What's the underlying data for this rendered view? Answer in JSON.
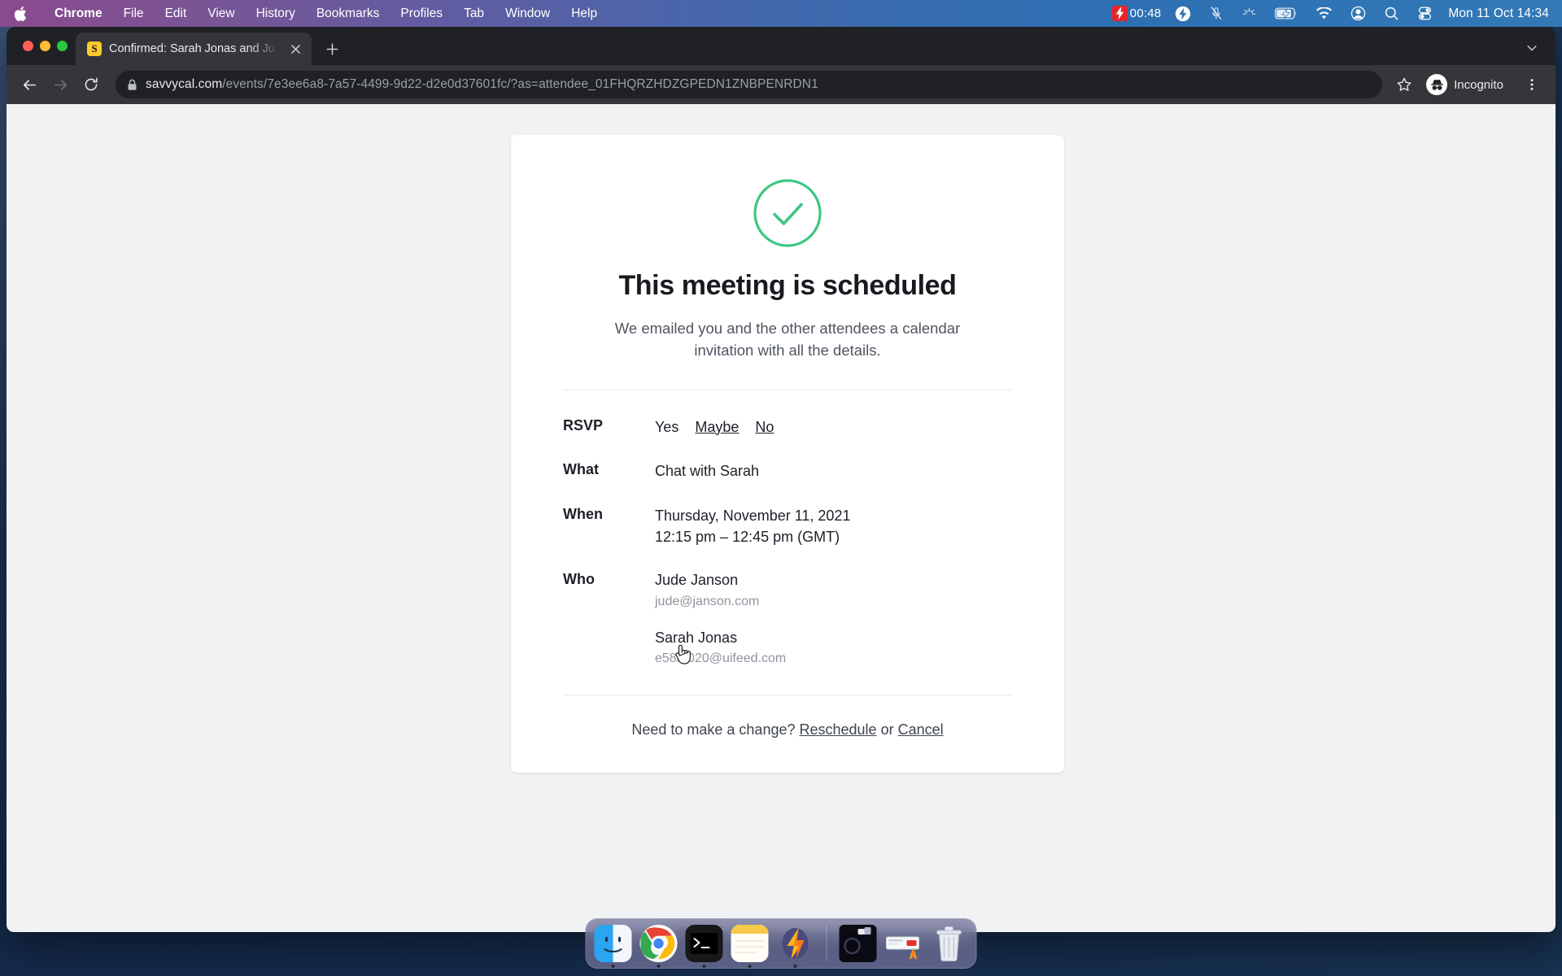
{
  "menubar": {
    "apple_icon": "apple-logo",
    "items": [
      "Chrome",
      "File",
      "Edit",
      "View",
      "History",
      "Bookmarks",
      "Profiles",
      "Tab",
      "Window",
      "Help"
    ],
    "active_app": "Chrome",
    "status": {
      "recording_time": "00:48",
      "icons": [
        "bolt-icon",
        "microphone-muted-icon",
        "brightness-icon",
        "battery-charging-icon",
        "wifi-icon",
        "user-circle-icon",
        "search-icon",
        "control-center-icon"
      ],
      "clock": "Mon 11 Oct  14:34"
    }
  },
  "browser": {
    "tab": {
      "favicon_letter": "S",
      "favicon_color": "#ffcb2b",
      "title": "Confirmed: Sarah Jonas and Ju",
      "close_icon": "close-icon"
    },
    "new_tab_label": "+",
    "toolbar": {
      "back_icon": "back-arrow-icon",
      "forward_icon": "forward-arrow-icon",
      "reload_icon": "reload-icon",
      "lock_icon": "lock-icon",
      "url_host": "savvycal.com",
      "url_path": "/events/7e3ee6a8-7a57-4499-9d22-d2e0d37601fc/?as=attendee_01FHQRZHDZGPEDN1ZNBPENRDN1",
      "bookmark_icon": "star-icon",
      "profile_label": "Incognito",
      "profile_icon": "incognito-icon",
      "menu_icon": "kebab-menu-icon"
    }
  },
  "page": {
    "status_icon": "check-circle-icon",
    "accent_color": "#3dc683",
    "heading": "This meeting is scheduled",
    "subtitle": "We emailed you and the other attendees a calendar invitation with all the details.",
    "rows": {
      "rsvp_label": "RSVP",
      "rsvp_options": [
        {
          "label": "Yes",
          "selected": true
        },
        {
          "label": "Maybe",
          "selected": false
        },
        {
          "label": "No",
          "selected": false
        }
      ],
      "what_label": "What",
      "what_value": "Chat with Sarah",
      "when_label": "When",
      "when_date": "Thursday, November 11, 2021",
      "when_time": "12:15 pm – 12:45 pm (GMT)",
      "who_label": "Who",
      "attendees": [
        {
          "name": "Jude Janson",
          "email": "jude@janson.com"
        },
        {
          "name": "Sarah Jonas",
          "email": "e58af020@uifeed.com"
        }
      ]
    },
    "footer": {
      "prefix": "Need to make a change?",
      "reschedule_label": "Reschedule",
      "conjunction": "or",
      "cancel_label": "Cancel"
    }
  },
  "dock": {
    "items": [
      {
        "name": "finder",
        "running": true
      },
      {
        "name": "chrome",
        "running": true
      },
      {
        "name": "terminal",
        "running": true
      },
      {
        "name": "notes",
        "running": true
      },
      {
        "name": "flash-app",
        "running": true
      },
      {
        "name": "screen-recorder",
        "running": false
      },
      {
        "name": "widget",
        "running": false
      },
      {
        "name": "trash",
        "running": false
      }
    ]
  }
}
